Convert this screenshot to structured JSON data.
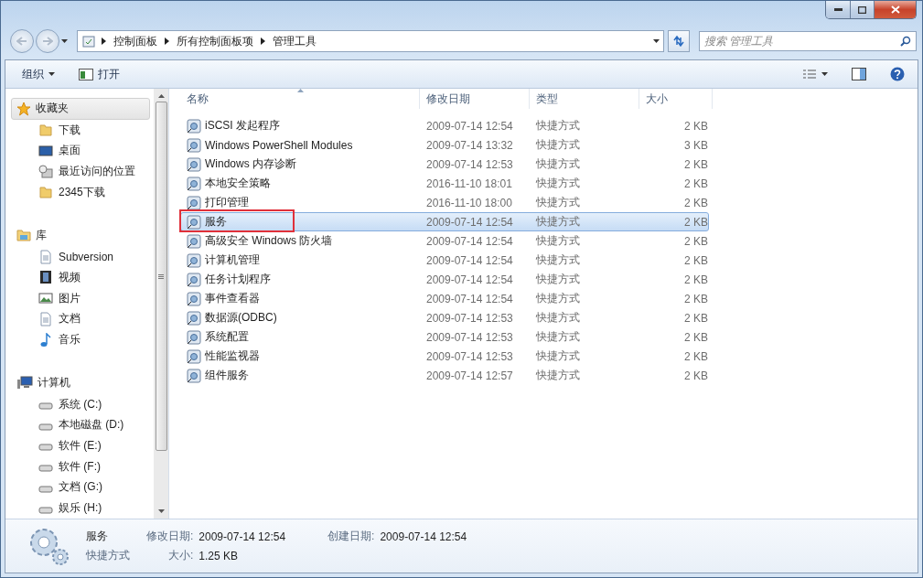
{
  "address": {
    "crumbs": [
      "控制面板",
      "所有控制面板项",
      "管理工具"
    ]
  },
  "search": {
    "placeholder": "搜索 管理工具"
  },
  "toolbar": {
    "organize": "组织",
    "open": "打开"
  },
  "sidebar": {
    "groups": [
      {
        "label": "收藏夹",
        "kind": "favorites",
        "selected": true,
        "items": [
          {
            "label": "下载",
            "kind": "folder"
          },
          {
            "label": "桌面",
            "kind": "desktop"
          },
          {
            "label": "最近访问的位置",
            "kind": "recent"
          },
          {
            "label": "2345下载",
            "kind": "folder"
          }
        ]
      },
      {
        "label": "库",
        "kind": "libraries",
        "selected": false,
        "items": [
          {
            "label": "Subversion",
            "kind": "document"
          },
          {
            "label": "视频",
            "kind": "video"
          },
          {
            "label": "图片",
            "kind": "picture"
          },
          {
            "label": "文档",
            "kind": "document"
          },
          {
            "label": "音乐",
            "kind": "music"
          }
        ]
      },
      {
        "label": "计算机",
        "kind": "computer",
        "selected": false,
        "items": [
          {
            "label": "系统 (C:)",
            "kind": "drive"
          },
          {
            "label": "本地磁盘 (D:)",
            "kind": "drive"
          },
          {
            "label": "软件 (E:)",
            "kind": "drive"
          },
          {
            "label": "软件 (F:)",
            "kind": "drive"
          },
          {
            "label": "文档 (G:)",
            "kind": "drive"
          },
          {
            "label": "娱乐 (H:)",
            "kind": "drive"
          }
        ]
      }
    ]
  },
  "table": {
    "columns": [
      "名称",
      "修改日期",
      "类型",
      "大小"
    ],
    "rows": [
      {
        "name": "iSCSI 发起程序",
        "date": "2009-07-14 12:54",
        "type": "快捷方式",
        "size": "2 KB",
        "selected": false,
        "highlighted": false
      },
      {
        "name": "Windows PowerShell Modules",
        "date": "2009-07-14 13:32",
        "type": "快捷方式",
        "size": "3 KB",
        "selected": false,
        "highlighted": false
      },
      {
        "name": "Windows 内存诊断",
        "date": "2009-07-14 12:53",
        "type": "快捷方式",
        "size": "2 KB",
        "selected": false,
        "highlighted": false
      },
      {
        "name": "本地安全策略",
        "date": "2016-11-10 18:01",
        "type": "快捷方式",
        "size": "2 KB",
        "selected": false,
        "highlighted": false
      },
      {
        "name": "打印管理",
        "date": "2016-11-10 18:00",
        "type": "快捷方式",
        "size": "2 KB",
        "selected": false,
        "highlighted": false
      },
      {
        "name": "服务",
        "date": "2009-07-14 12:54",
        "type": "快捷方式",
        "size": "2 KB",
        "selected": true,
        "highlighted": true
      },
      {
        "name": "高级安全 Windows 防火墙",
        "date": "2009-07-14 12:54",
        "type": "快捷方式",
        "size": "2 KB",
        "selected": false,
        "highlighted": false
      },
      {
        "name": "计算机管理",
        "date": "2009-07-14 12:54",
        "type": "快捷方式",
        "size": "2 KB",
        "selected": false,
        "highlighted": false
      },
      {
        "name": "任务计划程序",
        "date": "2009-07-14 12:54",
        "type": "快捷方式",
        "size": "2 KB",
        "selected": false,
        "highlighted": false
      },
      {
        "name": "事件查看器",
        "date": "2009-07-14 12:54",
        "type": "快捷方式",
        "size": "2 KB",
        "selected": false,
        "highlighted": false
      },
      {
        "name": "数据源(ODBC)",
        "date": "2009-07-14 12:53",
        "type": "快捷方式",
        "size": "2 KB",
        "selected": false,
        "highlighted": false
      },
      {
        "name": "系统配置",
        "date": "2009-07-14 12:53",
        "type": "快捷方式",
        "size": "2 KB",
        "selected": false,
        "highlighted": false
      },
      {
        "name": "性能监视器",
        "date": "2009-07-14 12:53",
        "type": "快捷方式",
        "size": "2 KB",
        "selected": false,
        "highlighted": false
      },
      {
        "name": "组件服务",
        "date": "2009-07-14 12:57",
        "type": "快捷方式",
        "size": "2 KB",
        "selected": false,
        "highlighted": false
      }
    ]
  },
  "details": {
    "name": "服务",
    "type": "快捷方式",
    "modified_label": "修改日期:",
    "modified": "2009-07-14 12:54",
    "created_label": "创建日期:",
    "created": "2009-07-14 12:54",
    "size_label": "大小:",
    "size": "1.25 KB"
  }
}
